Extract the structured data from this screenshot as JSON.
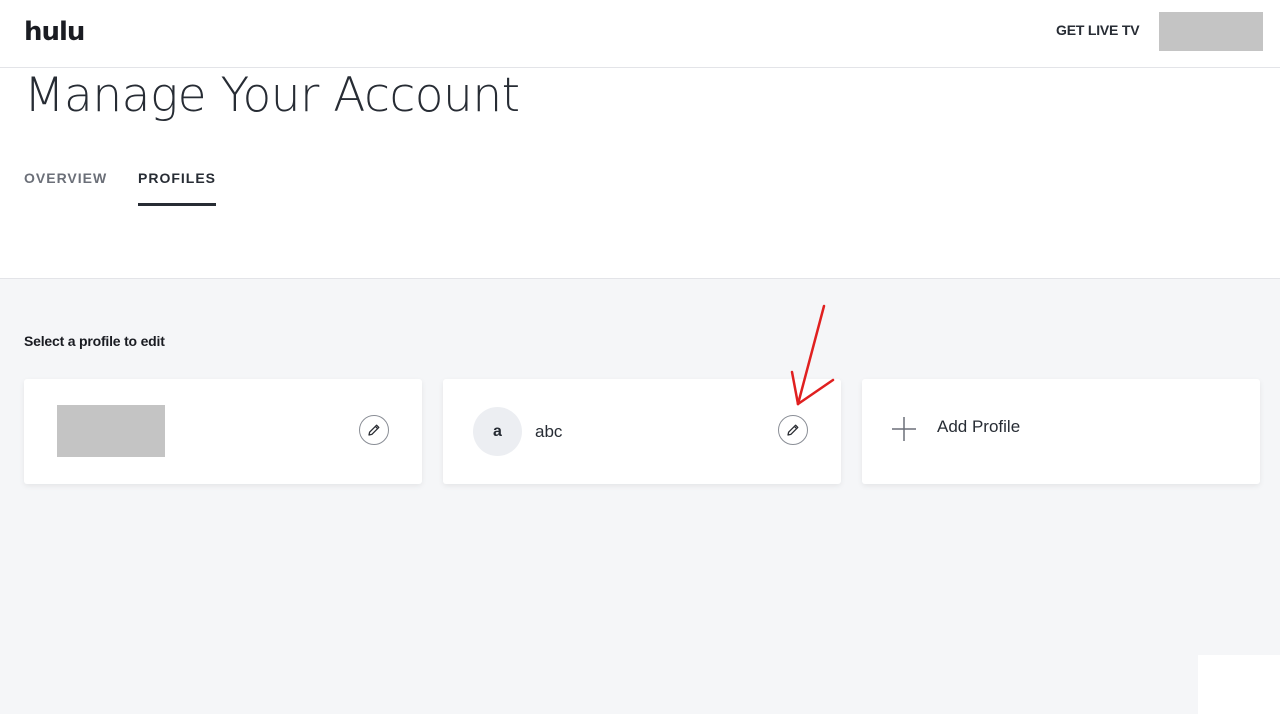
{
  "header": {
    "logo": "hulu",
    "live_tv_link": "GET LIVE TV",
    "account_menu": "account-menu-redacted"
  },
  "page": {
    "title": "Manage Your Account",
    "tabs": [
      {
        "label": "OVERVIEW",
        "active": false
      },
      {
        "label": "PROFILES",
        "active": true
      }
    ]
  },
  "profiles_section": {
    "select_label": "Select a profile to edit",
    "profiles": [
      {
        "name": "",
        "redacted": true,
        "edit_icon": "pencil-icon"
      },
      {
        "initial": "a",
        "name": "abc",
        "edit_icon": "pencil-icon"
      }
    ],
    "add_profile_label": "Add Profile",
    "add_icon": "plus-icon"
  },
  "annotation": {
    "type": "arrow",
    "color": "#e02020",
    "points_to": "edit-profile-abc-button"
  },
  "colors": {
    "page_background": "#f5f6f8",
    "card_background": "#ffffff",
    "text_primary": "#272c34",
    "text_muted": "#6b6f78",
    "redaction": "#c4c4c4",
    "annotation": "#e02020"
  }
}
